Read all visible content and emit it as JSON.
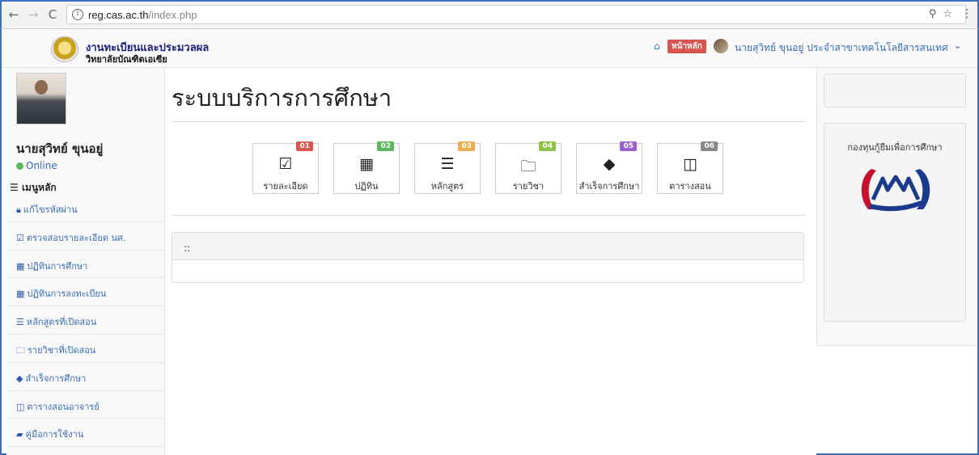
{
  "browser": {
    "url_host": "reg.cas.ac.th",
    "url_path": "/index.php"
  },
  "header": {
    "brand_title": "งานทะเบียนและประมวลผล",
    "brand_subtitle": "วิทยาลัยบัณฑิตเอเซีย",
    "home_label": "หน้าหลัก",
    "user_label": "นายสุวิทย์ ขุนอยู่  ประจำสาขาเทคโนโลยีสารสนเทศ"
  },
  "sidebar": {
    "user_name": "นายสุวิทย์ ขุนอยู่",
    "status": "Online",
    "menu_title": "เมนูหลัก",
    "items": [
      {
        "icon": "lock-icon",
        "label": "แก้ไขรหัสผ่าน"
      },
      {
        "icon": "check-square-icon",
        "label": "ตรวจสอบรายละเอียด นศ."
      },
      {
        "icon": "calendar-icon",
        "label": "ปฏิทินการศึกษา"
      },
      {
        "icon": "calendar-icon",
        "label": "ปฏิทินการลงทะเบียน"
      },
      {
        "icon": "list-icon",
        "label": "หลักสูตรที่เปิดสอน"
      },
      {
        "icon": "folder-icon",
        "label": "รายวิชาที่เปิดสอน"
      },
      {
        "icon": "tag-icon",
        "label": "สำเร็จการศึกษา"
      },
      {
        "icon": "table-icon",
        "label": "ตารางสอนอาจารย์"
      },
      {
        "icon": "book-icon",
        "label": "คู่มือการใช้งาน"
      }
    ]
  },
  "main": {
    "title": "ระบบบริการการศึกษา",
    "tiles": [
      {
        "num": "01",
        "label": "รายละเอียด",
        "icon": "check-square-icon",
        "color": "#d9534f"
      },
      {
        "num": "02",
        "label": "ปฏิทิน",
        "icon": "calendar-icon",
        "color": "#5cb85c"
      },
      {
        "num": "03",
        "label": "หลักสูตร",
        "icon": "list-icon",
        "color": "#f0ad4e"
      },
      {
        "num": "04",
        "label": "รายวิชา",
        "icon": "folder-icon",
        "color": "#8bc34a"
      },
      {
        "num": "05",
        "label": "สำเร็จการศึกษา",
        "icon": "tag-icon",
        "color": "#9c5fd0"
      },
      {
        "num": "06",
        "label": "ตารางสอน",
        "icon": "table-icon",
        "color": "#888888"
      }
    ],
    "panel_heading": "::"
  },
  "right": {
    "fund_title": "กองทุนกู้ยืมเพื่อการศึกษา"
  }
}
